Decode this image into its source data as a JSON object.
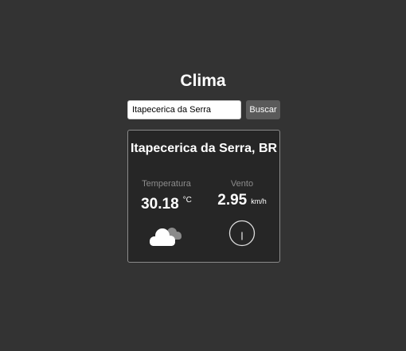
{
  "app": {
    "title": "Clima"
  },
  "search": {
    "value": "Itapecerica da Serra",
    "button_label": "Buscar"
  },
  "weather": {
    "city": "Itapecerica da Serra, BR",
    "temperature_label": "Temperatura",
    "temperature_value": "30.18",
    "temperature_unit": "°C",
    "wind_label": "Vento",
    "wind_value": "2.95",
    "wind_unit": "km/h",
    "condition_icon": "cloud-icon",
    "wind_icon": "wind-direction-icon"
  },
  "colors": {
    "background": "#333333",
    "card_background": "#262626",
    "card_border": "#8a8a8a",
    "button": "#5a5a5a",
    "muted_text": "#8c8c8c"
  }
}
